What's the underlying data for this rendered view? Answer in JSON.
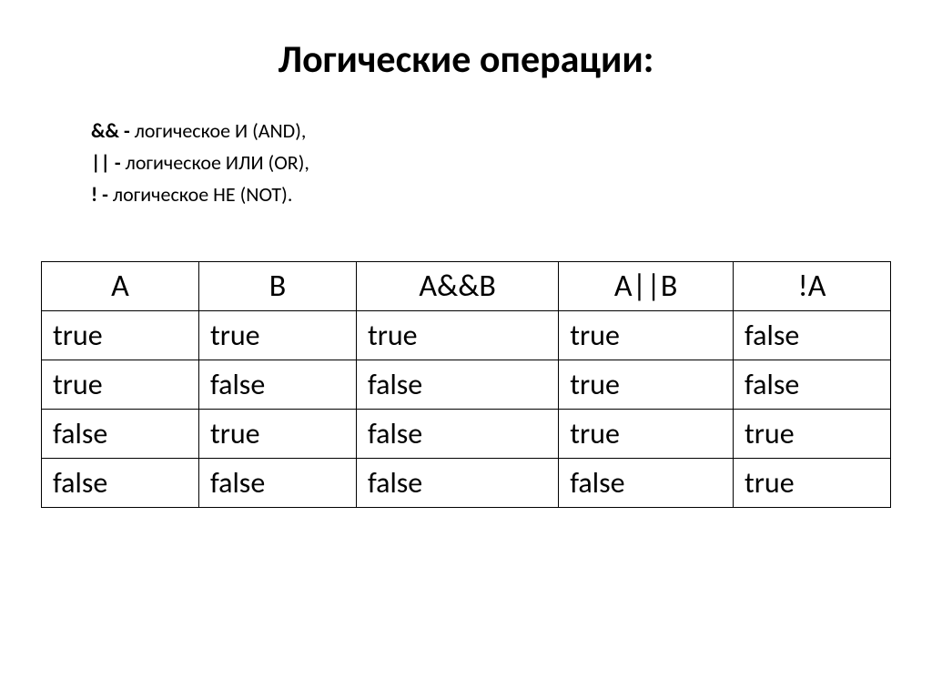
{
  "title": "Логические операции:",
  "definitions": [
    {
      "op": "&& - ",
      "desc": "логическое И (AND),"
    },
    {
      "op": "|| - ",
      "desc": "логическое ИЛИ (OR),"
    },
    {
      "op": "! - ",
      "desc": "логическое НЕ (NOT)."
    }
  ],
  "chart_data": {
    "type": "table",
    "headers": [
      "A",
      "B",
      "A&&B",
      "A||B",
      "!A"
    ],
    "rows": [
      [
        "true",
        "true",
        "true",
        "true",
        "false"
      ],
      [
        "true",
        "false",
        "false",
        "true",
        "false"
      ],
      [
        "false",
        "true",
        "false",
        "true",
        "true"
      ],
      [
        "false",
        "false",
        "false",
        "false",
        "true"
      ]
    ]
  }
}
